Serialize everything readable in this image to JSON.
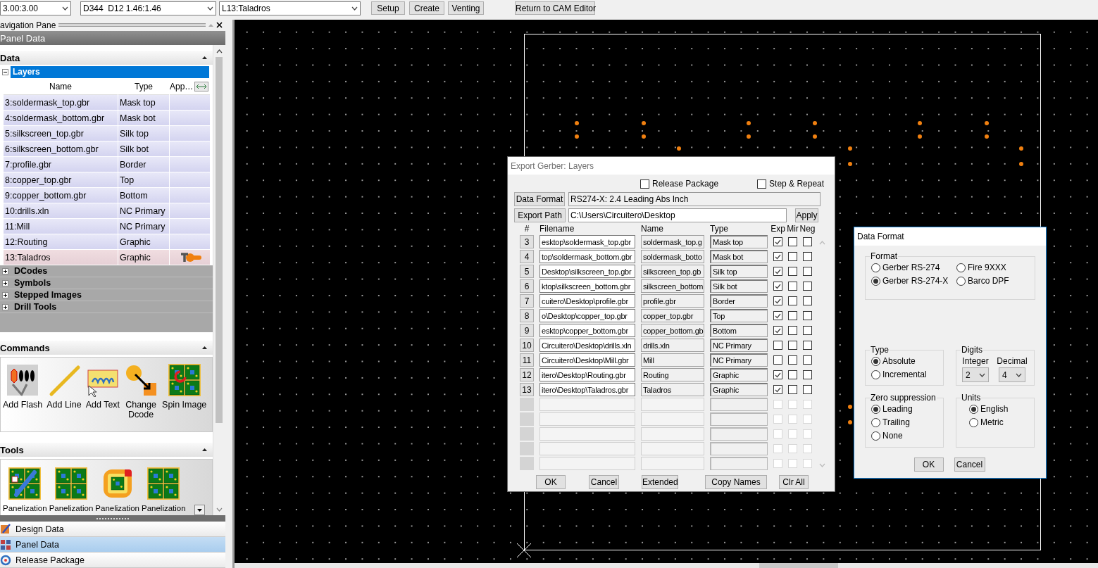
{
  "toolbar": {
    "combos": [
      {
        "value": "3.00:3.00"
      },
      {
        "value": "D344  D12 1.46:1.46"
      },
      {
        "value": "L13:Taladros"
      }
    ],
    "buttons": [
      "Setup",
      "Create",
      "Venting",
      "Return to CAM Editor"
    ]
  },
  "navigation_pane": {
    "title": "avigation Pane",
    "panel_title": "Panel Data",
    "data": {
      "title": "Data",
      "layers": {
        "label": "Layers",
        "expanded": true
      },
      "columns": [
        "Name",
        "Type",
        "App…"
      ],
      "rows": [
        {
          "name": "3:soldermask_top.gbr",
          "type": "Mask top",
          "selected": false
        },
        {
          "name": "4:soldermask_bottom.gbr",
          "type": "Mask bot",
          "selected": false
        },
        {
          "name": "5:silkscreen_top.gbr",
          "type": "Silk top",
          "selected": false
        },
        {
          "name": "6:silkscreen_bottom.gbr",
          "type": "Silk bot",
          "selected": false
        },
        {
          "name": "7:profile.gbr",
          "type": "Border",
          "selected": false
        },
        {
          "name": "8:copper_top.gbr",
          "type": "Top",
          "selected": false
        },
        {
          "name": "9:copper_bottom.gbr",
          "type": "Bottom",
          "selected": false
        },
        {
          "name": "10:drills.xln",
          "type": "NC Primary",
          "selected": false
        },
        {
          "name": "11:Mill",
          "type": "NC Primary",
          "selected": false
        },
        {
          "name": "12:Routing",
          "type": "Graphic",
          "selected": false
        },
        {
          "name": "13:Taladros",
          "type": "Graphic",
          "selected": true
        }
      ],
      "groups": [
        {
          "label": "DCodes",
          "expanded": false
        },
        {
          "label": "Symbols",
          "expanded": false
        },
        {
          "label": "Stepped Images",
          "expanded": false
        },
        {
          "label": "Drill Tools",
          "expanded": false
        }
      ]
    },
    "commands": {
      "title": "Commands",
      "items": [
        {
          "kind": "flash",
          "lines": [
            "Add Flash"
          ]
        },
        {
          "kind": "line",
          "lines": [
            "Add Line"
          ]
        },
        {
          "kind": "text",
          "lines": [
            "Add Text"
          ]
        },
        {
          "kind": "dcode",
          "lines": [
            "Change",
            "Dcode"
          ]
        },
        {
          "kind": "spin",
          "lines": [
            "Spin Image"
          ]
        }
      ]
    },
    "tools": {
      "title": "Tools",
      "items": [
        {
          "kind": "setup",
          "label": "Panelization"
        },
        {
          "kind": "create",
          "label": "Panelization"
        },
        {
          "kind": "venting",
          "label": "Panelization"
        },
        {
          "kind": "rotate",
          "label": "Panelization"
        }
      ]
    },
    "bottom_nav": [
      {
        "kind": "design",
        "label": "Design Data",
        "selected": false
      },
      {
        "kind": "panel",
        "label": "Panel Data",
        "selected": true
      },
      {
        "kind": "release",
        "label": "Release Package",
        "selected": false
      }
    ]
  },
  "export_dialog": {
    "title": "Export Gerber: Layers",
    "options": [
      {
        "label": "Release Package",
        "checked": false
      },
      {
        "label": "Step & Repeat",
        "checked": false
      }
    ],
    "data_format": {
      "button": "Data Format",
      "value": "RS274-X: 2.4 Leading Abs Inch"
    },
    "export_path": {
      "button": "Export Path",
      "value": "C:\\Users\\Circuitero\\Desktop",
      "apply": "Apply"
    },
    "columns": [
      "#",
      "Filename",
      "Name",
      "Type",
      "Exp",
      "Mir",
      "Neg"
    ],
    "rows": [
      {
        "kind": "layer",
        "number": "3",
        "filename": "esktop\\soldermask_top.gbr",
        "name": "soldermask_top.g",
        "type": "Mask top",
        "exp": true,
        "mir": false,
        "neg": false
      },
      {
        "kind": "layer",
        "number": "4",
        "filename": "top\\soldermask_bottom.gbr",
        "name": "soldermask_botto",
        "type": "Mask bot",
        "exp": true,
        "mir": false,
        "neg": false
      },
      {
        "kind": "layer",
        "number": "5",
        "filename": "Desktop\\silkscreen_top.gbr",
        "name": "silkscreen_top.gb",
        "type": "Silk top",
        "exp": true,
        "mir": false,
        "neg": false
      },
      {
        "kind": "layer",
        "number": "6",
        "filename": "ktop\\silkscreen_bottom.gbr",
        "name": "silkscreen_bottom",
        "type": "Silk bot",
        "exp": true,
        "mir": false,
        "neg": false
      },
      {
        "kind": "layer",
        "number": "7",
        "filename": "cuitero\\Desktop\\profile.gbr",
        "name": "profile.gbr",
        "type": "Border",
        "exp": true,
        "mir": false,
        "neg": false
      },
      {
        "kind": "layer",
        "number": "8",
        "filename": "o\\Desktop\\copper_top.gbr",
        "name": "copper_top.gbr",
        "type": "Top",
        "exp": true,
        "mir": false,
        "neg": false
      },
      {
        "kind": "layer",
        "number": "9",
        "filename": "esktop\\copper_bottom.gbr",
        "name": "copper_bottom.gb",
        "type": "Bottom",
        "exp": true,
        "mir": false,
        "neg": false
      },
      {
        "kind": "layer",
        "number": "10",
        "filename": "Circuitero\\Desktop\\drills.xln",
        "name": "drills.xln",
        "type": "NC Primary",
        "exp": false,
        "mir": false,
        "neg": false
      },
      {
        "kind": "layer",
        "number": "11",
        "filename": "Circuitero\\Desktop\\Mill.gbr",
        "name": "Mill",
        "type": "NC Primary",
        "exp": false,
        "mir": false,
        "neg": false
      },
      {
        "kind": "layer",
        "number": "12",
        "filename": "itero\\Desktop\\Routing.gbr",
        "name": "Routing",
        "type": "Graphic",
        "exp": true,
        "mir": false,
        "neg": false
      },
      {
        "kind": "layer",
        "number": "13",
        "filename": "itero\\Desktop\\Taladros.gbr",
        "name": "Taladros",
        "type": "Graphic",
        "exp": true,
        "mir": false,
        "neg": false
      },
      {
        "kind": "empty",
        "disabled": true,
        "exp": false,
        "mir": false,
        "neg": false
      },
      {
        "kind": "empty",
        "disabled": true,
        "exp": false,
        "mir": false,
        "neg": false
      },
      {
        "kind": "empty",
        "disabled": true,
        "exp": false,
        "mir": false,
        "neg": false
      },
      {
        "kind": "empty",
        "disabled": true,
        "exp": false,
        "mir": false,
        "neg": false
      },
      {
        "kind": "empty",
        "disabled": true,
        "exp": false,
        "mir": false,
        "neg": false
      }
    ],
    "buttons": [
      "OK",
      "Cancel",
      "Extended",
      "Copy Names",
      "Clr All"
    ]
  },
  "format_dialog": {
    "title": "Data Format",
    "format": {
      "legend": "Format",
      "options": [
        {
          "label": "Gerber RS-274",
          "selected": false
        },
        {
          "label": "Fire 9XXX",
          "selected": false
        },
        {
          "label": "Gerber RS-274-X",
          "selected": true
        },
        {
          "label": "Barco DPF",
          "selected": false
        }
      ]
    },
    "type": {
      "legend": "Type",
      "options": [
        {
          "label": "Absolute",
          "selected": true
        },
        {
          "label": "Incremental",
          "selected": false
        }
      ]
    },
    "digits": {
      "legend": "Digits",
      "fields": [
        {
          "label": "Integer",
          "value": "2"
        },
        {
          "label": "Decimal",
          "value": "4"
        }
      ]
    },
    "zero_suppression": {
      "legend": "Zero suppression",
      "options": [
        {
          "label": "Leading",
          "selected": true
        },
        {
          "label": "Trailing",
          "selected": false
        },
        {
          "label": "None",
          "selected": false
        }
      ]
    },
    "units": {
      "legend": "Units",
      "options": [
        {
          "label": "English",
          "selected": true
        },
        {
          "label": "Metric",
          "selected": false
        }
      ]
    },
    "buttons": [
      "OK",
      "Cancel"
    ]
  }
}
